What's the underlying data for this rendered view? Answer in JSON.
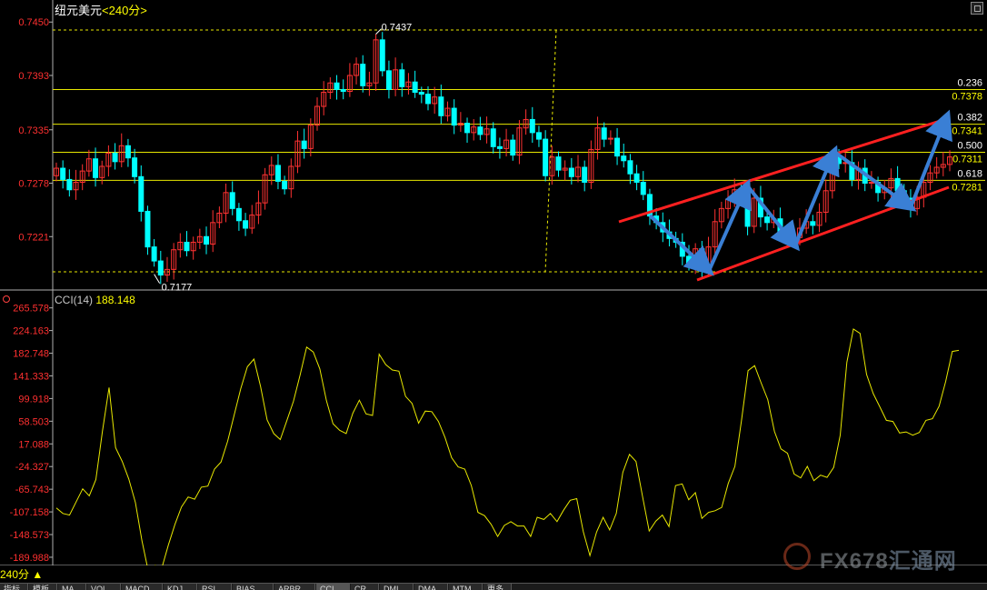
{
  "window": {
    "title": "纽元美元",
    "timeframe": "<240分>"
  },
  "colors": {
    "up": "#ff3232",
    "down": "#00ffff",
    "fib": "#e8e800",
    "channel": "#ff2020",
    "arrow": "#3a7fd5",
    "cci": "#e8e800",
    "axis": "#ff3030"
  },
  "chart_data": [
    {
      "type": "candlestick",
      "title": "纽元美元<240分>",
      "y_ticks": [
        "0.7450",
        "0.7393",
        "0.7335",
        "0.7278",
        "0.7221"
      ],
      "ylim": [
        0.7165,
        0.7458
      ],
      "annotations": {
        "high": "0.7437",
        "low": "0.7177"
      },
      "fibonacci": [
        {
          "ratio": "0.236",
          "price": "0.7378"
        },
        {
          "ratio": "0.382",
          "price": "0.7341"
        },
        {
          "ratio": "0.500",
          "price": "0.7311"
        },
        {
          "ratio": "0.618",
          "price": "0.7281"
        }
      ],
      "closes": [
        0.7294,
        0.7282,
        0.7271,
        0.7279,
        0.7291,
        0.7304,
        0.7284,
        0.7296,
        0.731,
        0.7301,
        0.7318,
        0.7305,
        0.7285,
        0.7248,
        0.721,
        0.7195,
        0.718,
        0.7186,
        0.7207,
        0.7215,
        0.7206,
        0.7215,
        0.7221,
        0.7213,
        0.7236,
        0.7246,
        0.7268,
        0.7251,
        0.7238,
        0.723,
        0.7244,
        0.7257,
        0.7287,
        0.7297,
        0.728,
        0.7272,
        0.7296,
        0.7323,
        0.7315,
        0.734,
        0.736,
        0.7375,
        0.7385,
        0.7378,
        0.7376,
        0.7393,
        0.7405,
        0.7382,
        0.7385,
        0.7431,
        0.7398,
        0.7378,
        0.7399,
        0.7381,
        0.7386,
        0.7375,
        0.7373,
        0.7363,
        0.737,
        0.735,
        0.7358,
        0.734,
        0.7342,
        0.7332,
        0.7338,
        0.733,
        0.7336,
        0.7317,
        0.7315,
        0.7324,
        0.7308,
        0.7337,
        0.7346,
        0.7332,
        0.7325,
        0.7286,
        0.7306,
        0.7292,
        0.7294,
        0.7285,
        0.7295,
        0.7279,
        0.7314,
        0.7337,
        0.7325,
        0.7326,
        0.7307,
        0.7302,
        0.7288,
        0.7279,
        0.7266,
        0.7243,
        0.7236,
        0.7226,
        0.7219,
        0.7215,
        0.72,
        0.7192,
        0.7208,
        0.7184,
        0.721,
        0.7237,
        0.7251,
        0.7261,
        0.7271,
        0.7265,
        0.7232,
        0.7262,
        0.7242,
        0.7236,
        0.724,
        0.7226,
        0.7222,
        0.722,
        0.723,
        0.7237,
        0.7233,
        0.7247,
        0.727,
        0.7306,
        0.7299,
        0.73,
        0.7282,
        0.7294,
        0.7278,
        0.7279,
        0.7268,
        0.7273,
        0.7283,
        0.727,
        0.7262,
        0.7251,
        0.7263,
        0.7279,
        0.7289,
        0.7295,
        0.7298,
        0.7306
      ]
    },
    {
      "type": "line",
      "title": "CCI(14)",
      "series": [
        {
          "name": "CCI(14)",
          "last_value": "188.148"
        }
      ],
      "y_ticks": [
        "265.578",
        "224.163",
        "182.748",
        "141.333",
        "99.918",
        "58.503",
        "17.088",
        "-24.327",
        "-65.743",
        "-107.158",
        "-148.573",
        "-189.988"
      ],
      "ylim": [
        -205,
        270
      ],
      "values": [
        -100,
        -110,
        -113,
        -89,
        -65,
        -78,
        -48,
        40,
        120,
        10,
        -15,
        -47,
        -90,
        -160,
        -218,
        -205,
        -210,
        -168,
        -130,
        -98,
        -80,
        -84,
        -62,
        -60,
        -29,
        -16,
        22,
        70,
        118,
        158,
        172,
        122,
        61,
        36,
        25,
        60,
        95,
        143,
        194,
        185,
        154,
        96,
        54,
        42,
        36,
        73,
        97,
        72,
        69,
        181,
        162,
        152,
        150,
        104,
        91,
        55,
        77,
        76,
        58,
        29,
        -8,
        -25,
        -29,
        -59,
        -108,
        -114,
        -130,
        -152,
        -132,
        -125,
        -133,
        -133,
        -152,
        -117,
        -121,
        -110,
        -125,
        -104,
        -86,
        -83,
        -144,
        -187,
        -144,
        -117,
        -140,
        -110,
        -35,
        -2,
        -15,
        -80,
        -142,
        -124,
        -113,
        -134,
        -59,
        -56,
        -85,
        -72,
        -119,
        -108,
        -105,
        -99,
        -55,
        -24,
        59,
        151,
        160,
        128,
        98,
        40,
        8,
        0,
        -38,
        -45,
        -24,
        -50,
        -40,
        -44,
        -26,
        33,
        166,
        227,
        219,
        144,
        109,
        85,
        60,
        58,
        37,
        39,
        33,
        38,
        60,
        63,
        86,
        131,
        186,
        188
      ]
    }
  ],
  "cci_panel": {
    "label": "CCI(14)",
    "value": "188.148"
  },
  "timeframe_button": "240分 ▲",
  "bottom_tabs": [
    "指标",
    "模板",
    "MA",
    "VOL",
    "MACD",
    "KDJ",
    "RSI",
    "BIAS",
    "ARBR",
    "CCI",
    "CR",
    "DMI",
    "DMA",
    "MTM",
    "更多"
  ],
  "watermark": {
    "text": "FX678",
    "cn": "汇通网"
  }
}
